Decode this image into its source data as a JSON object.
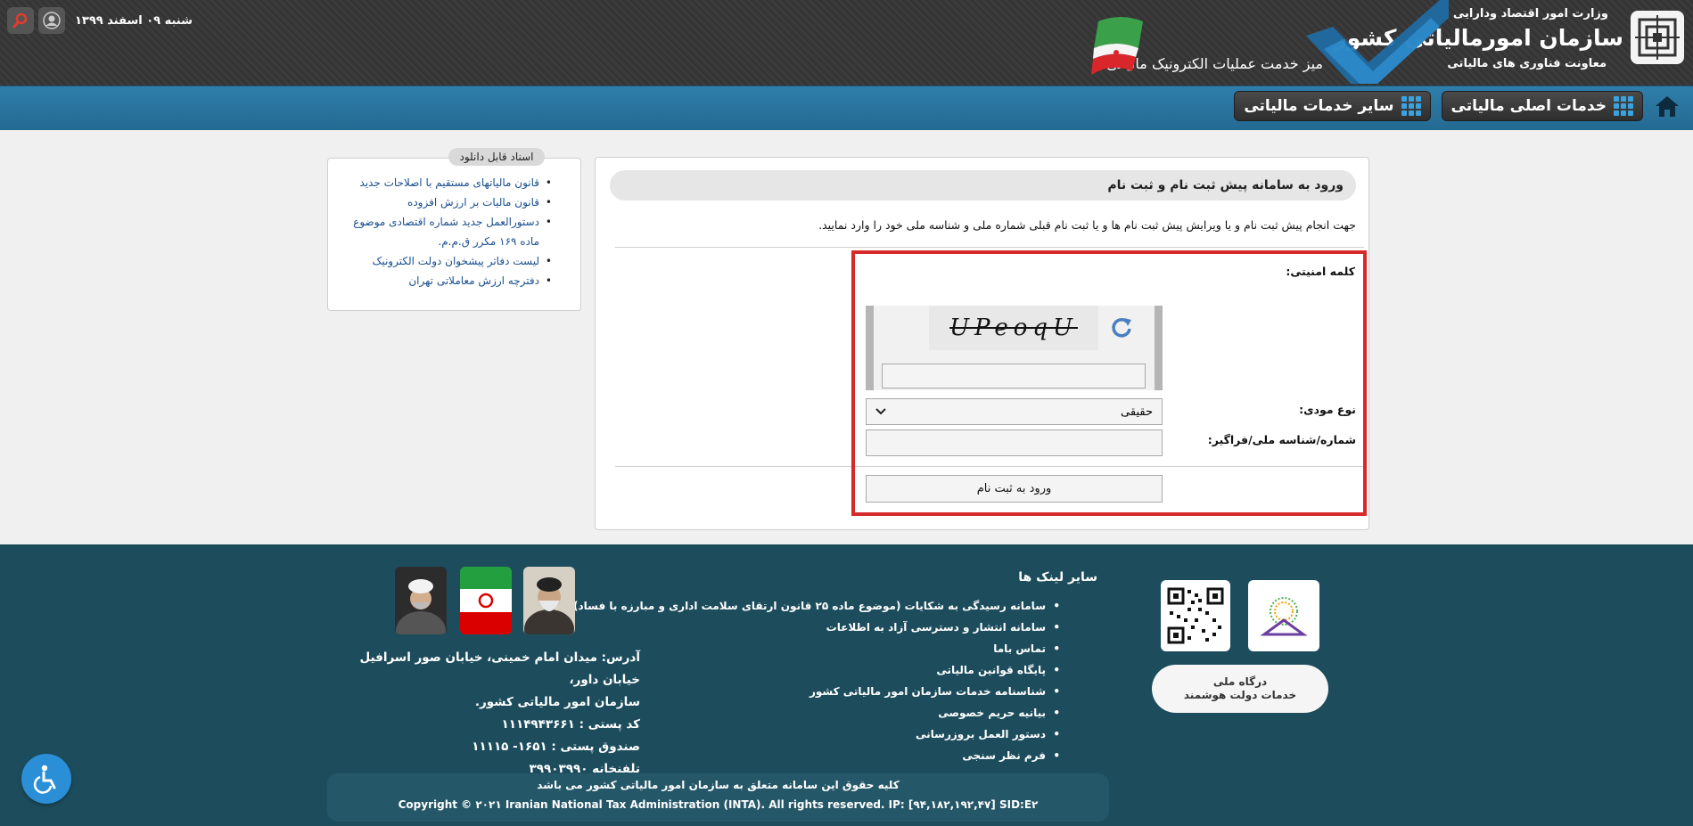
{
  "header": {
    "ministry": "وزارت امور اقتصاد ودارایی",
    "org_name": "سازمان امورمالیاتی کشور",
    "deputy": "معاونت فناوری های مالیاتی",
    "desk_title": "میز خدمت عملیات الکترونیک مالیاتی",
    "date": "شنبه ۰۹ اسفند ۱۳۹۹"
  },
  "nav": {
    "main_services": "خدمات اصلی مالیاتی",
    "other_services": "سایر خدمات مالیاتی"
  },
  "main": {
    "title": "ورود به سامانه پیش ثبت نام و ثبت نام",
    "description": "جهت انجام پیش ثبت نام و یا ویرایش پیش ثبت نام ها و یا ثبت نام قبلی شماره ملی و شناسه ملی خود را وارد نمایید.",
    "captcha_label": "کلمه امنیتی:",
    "captcha_text": "UPeoqU",
    "captcha_input_value": "",
    "taxpayer_type_label": "نوع مودی:",
    "taxpayer_type_value": "حقیقی",
    "national_id_label": "شماره/شناسه ملی/فراگیر:",
    "national_id_value": "",
    "submit_label": "ورود به ثبت نام"
  },
  "downloads": {
    "title": "اسناد قابل دانلود",
    "items": [
      "قانون مالیاتهای مستقیم با اصلاحات جدید",
      "قانون مالیات بر ارزش افزوده",
      "دستورالعمل جدید شماره اقتصادی موضوع ماده ۱۶۹ مکرر ق.م.م.",
      "لیست دفاتر پیشخوان دولت الکترونیک",
      "دفترچه ارزش معاملاتی تهران"
    ]
  },
  "footer": {
    "links_title": "سایر لینک ها",
    "links": [
      "سامانه رسیدگی به شکایات (موضوع ماده ۲۵ قانون ارتقای سلامت اداری و مبارزه با فساد)",
      "سامانه انتشار و دسترسی آزاد به اطلاعات",
      "تماس باما",
      "پایگاه قوانین مالیاتی",
      "شناسنامه خدمات سازمان امور مالیاتی کشور",
      "بیانیه حریم خصوصی",
      "دستور العمل بروزرسانی",
      "فرم نظر سنجی"
    ],
    "address_lines": [
      "آدرس: میدان امام خمینی، خیابان صور اسرافیل خیابان داور،",
      "سازمان امور مالیاتی کشور.",
      "کد پستی : ۱۱۱۴۹۴۳۶۶۱",
      "صندوق پستی : ۱۶۵۱- ۱۱۱۱۵",
      "تلفنخانه ۳۹۹۰۳۹۹۰"
    ],
    "egov_text_1": "درگاه ملی",
    "egov_text_2": "خدمات دولت هوشمند",
    "copyright_fa": "کلیه حقوق این سامانه متعلق به سازمان امور مالیاتی کشور می باشد",
    "copyright_en": "Copyright © ۲۰۲۱ Iranian National Tax Administration (INTA). All rights reserved. IP: [۹۴,۱۸۲,۱۹۲,۴۷] SID:E۲"
  },
  "colors": {
    "header_bg": "#383838",
    "nav_bar": "#2a76a2",
    "footer_bg": "#1d4d5d",
    "highlight_frame": "#d62a2a",
    "link": "#1a4f8f",
    "accessibility": "#2a8fd6"
  }
}
